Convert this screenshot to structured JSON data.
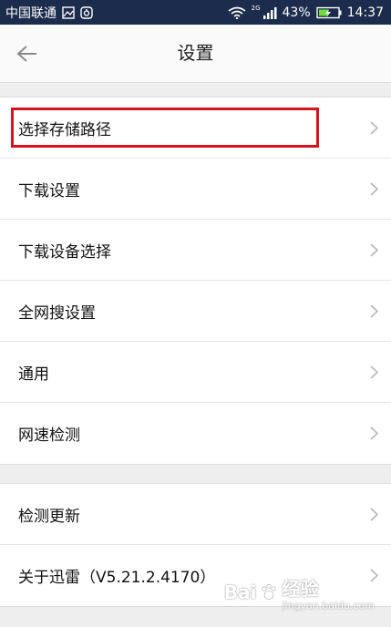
{
  "status_bar": {
    "carrier": "中国联通",
    "network_type": "2G",
    "battery": "43%",
    "time": "14:37",
    "icons": [
      "image-icon",
      "notification-icon",
      "wifi-icon",
      "signal-icon",
      "battery-icon"
    ]
  },
  "header": {
    "title": "设置",
    "back_icon": "arrow-left-icon"
  },
  "groups": [
    {
      "items": [
        {
          "label": "选择存储路径",
          "highlighted": true
        },
        {
          "label": "下载设置"
        },
        {
          "label": "下载设备选择"
        },
        {
          "label": "全网搜设置"
        },
        {
          "label": "通用"
        },
        {
          "label": "网速检测"
        }
      ]
    },
    {
      "items": [
        {
          "label": "检测更新"
        },
        {
          "label": "关于迅雷（V5.21.2.4170）"
        }
      ]
    }
  ],
  "watermark": {
    "text": "Bai",
    "suffix": "经验",
    "sub": "jingyan.baidu.com"
  },
  "colors": {
    "status_bar": "#1c2c4c",
    "highlight": "#d6141e",
    "chevron": "#b5b5b5"
  }
}
